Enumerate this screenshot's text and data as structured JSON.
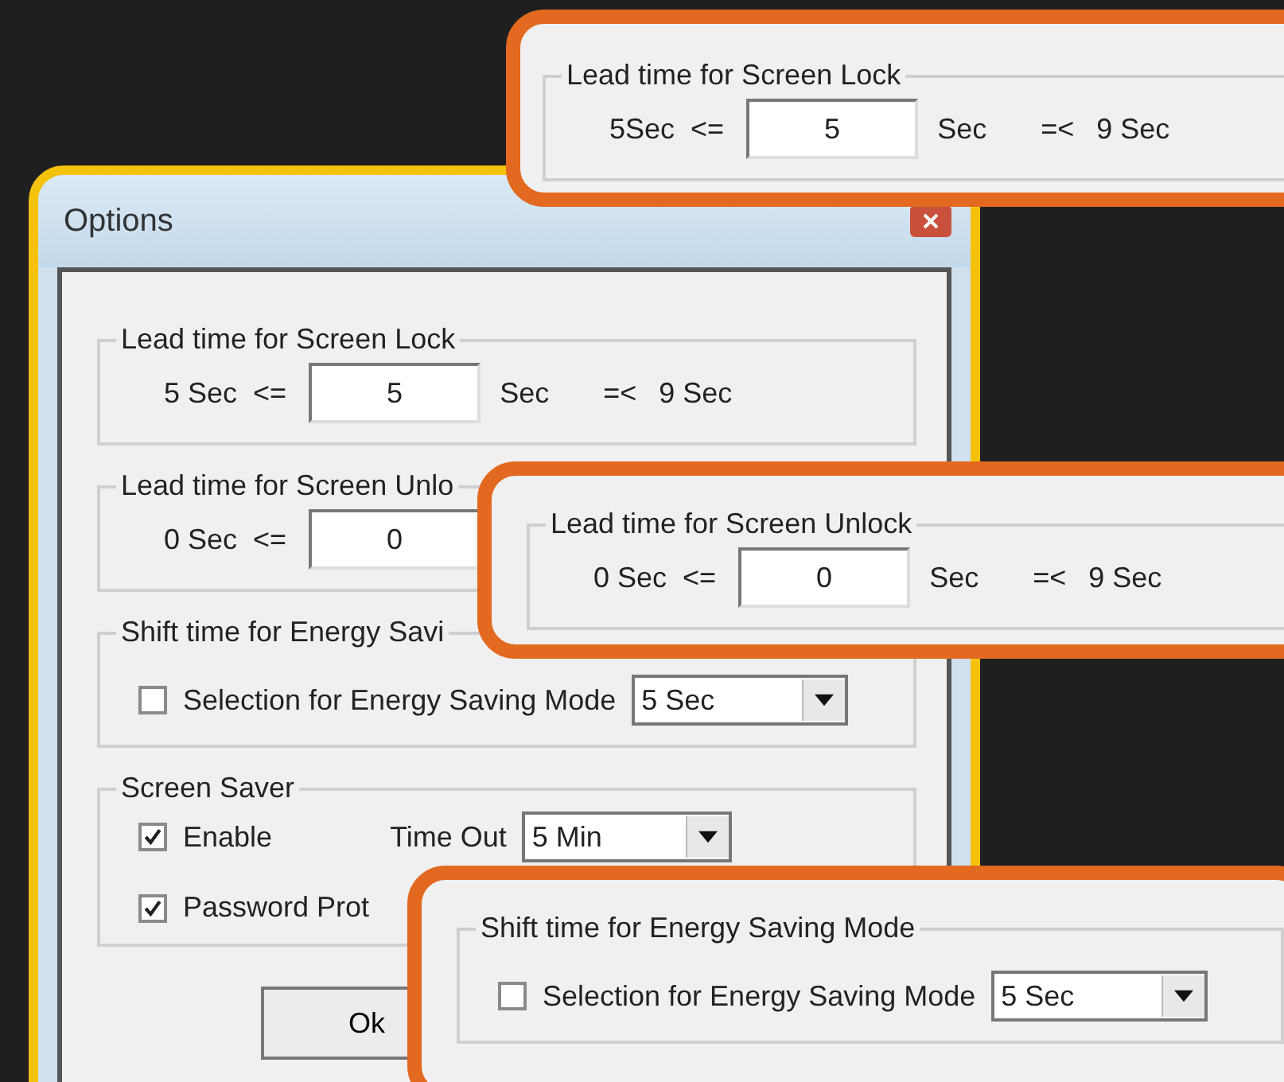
{
  "dialog": {
    "title": "Options",
    "groups": [
      {
        "kind": "range",
        "title": "Lead time for Screen Lock",
        "min_label": "5 Sec",
        "op_left": "<=",
        "value": "5",
        "unit": "Sec",
        "op_right": "=<",
        "max_label": "9 Sec"
      },
      {
        "kind": "range",
        "title": "Lead time for Screen Unlo",
        "min_label": "0 Sec",
        "op_left": "<=",
        "value": "0"
      },
      {
        "kind": "select",
        "title": "Shift time for Energy Savi",
        "checkbox": {
          "label": "Selection for Energy Saving Mode",
          "checked": false
        },
        "value": "5 Sec"
      },
      {
        "kind": "screensaver",
        "title": "Screen Saver",
        "enable": {
          "label": "Enable",
          "checked": true
        },
        "timeout_label": "Time Out",
        "timeout_value": "5 Min",
        "password": {
          "label": "Password Prot",
          "checked": true
        }
      }
    ],
    "ok_button": "Ok"
  },
  "callouts": [
    {
      "kind": "range",
      "title": "Lead time for Screen Lock",
      "min_label": "5Sec",
      "op_left": "<=",
      "value": "5",
      "unit": "Sec",
      "op_right": "=<",
      "max_label": "9 Sec"
    },
    {
      "kind": "range",
      "title": "Lead time for Screen Unlock",
      "min_label": "0 Sec",
      "op_left": "<=",
      "value": "0",
      "unit": "Sec",
      "op_right": "=<",
      "max_label": "9 Sec"
    },
    {
      "kind": "select",
      "title": "Shift time for Energy Saving Mode",
      "checkbox": {
        "label": "Selection for Energy Saving Mode",
        "checked": false
      },
      "value": "5 Sec"
    }
  ]
}
